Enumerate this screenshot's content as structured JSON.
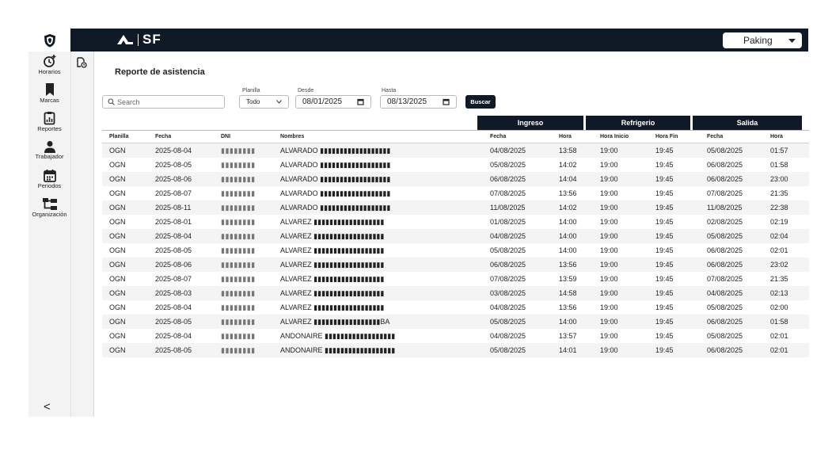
{
  "brand": {
    "name": "SF"
  },
  "company_select": {
    "value": "Paking"
  },
  "nav": [
    {
      "label": "Horarios",
      "icon": "clock-add-icon"
    },
    {
      "label": "Marcas",
      "icon": "bookmark-icon"
    },
    {
      "label": "Reportes",
      "icon": "report-icon"
    },
    {
      "label": "Trabajador",
      "icon": "person-icon"
    },
    {
      "label": "Periodos",
      "icon": "calendar-icon"
    },
    {
      "label": "Organización",
      "icon": "org-icon"
    }
  ],
  "collapse_label": "<",
  "page_title": "Reporte de asistencia",
  "search": {
    "placeholder": "Search"
  },
  "filters": {
    "planilla_label": "Planilla",
    "planilla_value": "Todo",
    "desde_label": "Desde",
    "desde_value": "08/01/2025",
    "hasta_label": "Hasta",
    "hasta_value": "08/13/2025",
    "buscar_label": "Buscar"
  },
  "groups": {
    "ingreso": "Ingreso",
    "refrigerio": "Refrigerio",
    "salida": "Salida"
  },
  "columns": [
    "Planilla",
    "Fecha",
    "DNI",
    "Nombres",
    "Fecha",
    "Hora",
    "Hora Inicio",
    "Hora Fin",
    "Fecha",
    "Hora"
  ],
  "rows": [
    [
      "OGN",
      "2025-08-04",
      "▮▮▮▮▮▮▮▮",
      "ALVARADO ▮▮▮▮▮▮▮▮▮▮▮▮▮▮▮▮▮▮",
      "04/08/2025",
      "13:58",
      "19:00",
      "19:45",
      "05/08/2025",
      "01:57"
    ],
    [
      "OGN",
      "2025-08-05",
      "▮▮▮▮▮▮▮▮",
      "ALVARADO ▮▮▮▮▮▮▮▮▮▮▮▮▮▮▮▮▮▮",
      "05/08/2025",
      "14:02",
      "19:00",
      "19:45",
      "06/08/2025",
      "01:58"
    ],
    [
      "OGN",
      "2025-08-06",
      "▮▮▮▮▮▮▮▮",
      "ALVARADO ▮▮▮▮▮▮▮▮▮▮▮▮▮▮▮▮▮▮",
      "06/08/2025",
      "14:04",
      "19:00",
      "19:45",
      "06/08/2025",
      "23:00"
    ],
    [
      "OGN",
      "2025-08-07",
      "▮▮▮▮▮▮▮▮",
      "ALVARADO ▮▮▮▮▮▮▮▮▮▮▮▮▮▮▮▮▮▮",
      "07/08/2025",
      "13:56",
      "19:00",
      "19:45",
      "07/08/2025",
      "21:35"
    ],
    [
      "OGN",
      "2025-08-11",
      "▮▮▮▮▮▮▮▮",
      "ALVARADO ▮▮▮▮▮▮▮▮▮▮▮▮▮▮▮▮▮▮",
      "11/08/2025",
      "14:02",
      "19:00",
      "19:45",
      "11/08/2025",
      "22:38"
    ],
    [
      "OGN",
      "2025-08-01",
      "▮▮▮▮▮▮▮▮",
      "ALVAREZ ▮▮▮▮▮▮▮▮▮▮▮▮▮▮▮▮▮▮",
      "01/08/2025",
      "14:00",
      "19:00",
      "19:45",
      "02/08/2025",
      "02:19"
    ],
    [
      "OGN",
      "2025-08-04",
      "▮▮▮▮▮▮▮▮",
      "ALVAREZ ▮▮▮▮▮▮▮▮▮▮▮▮▮▮▮▮▮▮",
      "04/08/2025",
      "14:00",
      "19:00",
      "19:45",
      "05/08/2025",
      "02:04"
    ],
    [
      "OGN",
      "2025-08-05",
      "▮▮▮▮▮▮▮▮",
      "ALVAREZ ▮▮▮▮▮▮▮▮▮▮▮▮▮▮▮▮▮▮",
      "05/08/2025",
      "14:00",
      "19:00",
      "19:45",
      "06/08/2025",
      "02:01"
    ],
    [
      "OGN",
      "2025-08-06",
      "▮▮▮▮▮▮▮▮",
      "ALVAREZ ▮▮▮▮▮▮▮▮▮▮▮▮▮▮▮▮▮▮",
      "06/08/2025",
      "13:56",
      "19:00",
      "19:45",
      "06/08/2025",
      "23:02"
    ],
    [
      "OGN",
      "2025-08-07",
      "▮▮▮▮▮▮▮▮",
      "ALVAREZ ▮▮▮▮▮▮▮▮▮▮▮▮▮▮▮▮▮▮",
      "07/08/2025",
      "13:59",
      "19:00",
      "19:45",
      "07/08/2025",
      "21:35"
    ],
    [
      "OGN",
      "2025-08-03",
      "▮▮▮▮▮▮▮▮",
      "ALVAREZ ▮▮▮▮▮▮▮▮▮▮▮▮▮▮▮▮▮▮",
      "03/08/2025",
      "14:58",
      "19:00",
      "19:45",
      "04/08/2025",
      "02:13"
    ],
    [
      "OGN",
      "2025-08-04",
      "▮▮▮▮▮▮▮▮",
      "ALVAREZ ▮▮▮▮▮▮▮▮▮▮▮▮▮▮▮▮▮▮",
      "04/08/2025",
      "13:56",
      "19:00",
      "19:45",
      "05/08/2025",
      "02:00"
    ],
    [
      "OGN",
      "2025-08-05",
      "▮▮▮▮▮▮▮▮",
      "ALVAREZ ▮▮▮▮▮▮▮▮▮▮▮▮▮▮▮▮▮BA",
      "05/08/2025",
      "14:00",
      "19:00",
      "19:45",
      "06/08/2025",
      "01:58"
    ],
    [
      "OGN",
      "2025-08-04",
      "▮▮▮▮▮▮▮▮",
      "ANDONAIRE ▮▮▮▮▮▮▮▮▮▮▮▮▮▮▮▮▮▮",
      "04/08/2025",
      "13:57",
      "19:00",
      "19:45",
      "05/08/2025",
      "02:01"
    ],
    [
      "OGN",
      "2025-08-05",
      "▮▮▮▮▮▮▮▮",
      "ANDONAIRE ▮▮▮▮▮▮▮▮▮▮▮▮▮▮▮▮▮▮",
      "05/08/2025",
      "14:01",
      "19:00",
      "19:45",
      "06/08/2025",
      "02:01"
    ]
  ],
  "colors": {
    "dark": "#0f1a26",
    "sidebar": "#f3f3f3",
    "stripe": "#f4f4f4"
  }
}
